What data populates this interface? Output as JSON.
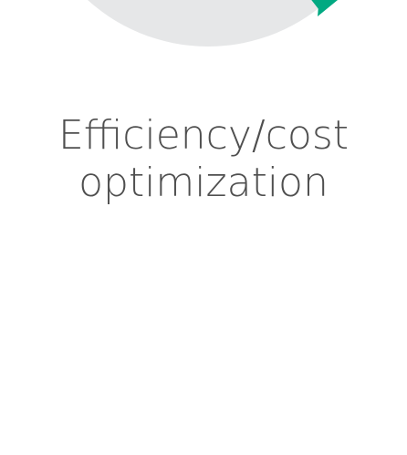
{
  "chart_data": {
    "type": "pie",
    "title": "Efficiency/cost optimization",
    "title_lines": [
      "Efficiency/cost",
      "optimization"
    ],
    "colors": {
      "track": "#e6e7e8",
      "highlight": "#01a982",
      "text": "#4f4f4f"
    }
  }
}
